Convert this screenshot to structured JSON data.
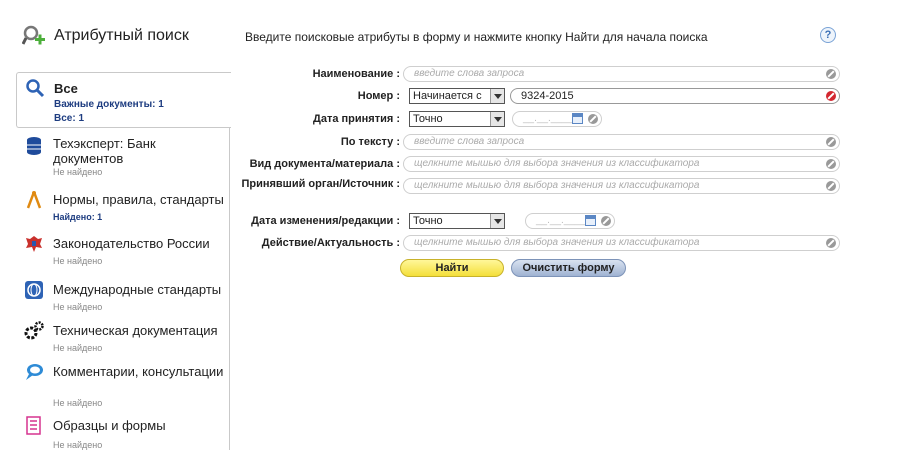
{
  "header": {
    "title": "Атрибутный поиск",
    "instruction": "Введите поисковые атрибуты в форму и нажмите кнопку Найти для начала поиска",
    "help": "?"
  },
  "sidebar": {
    "items": [
      {
        "label": "Все",
        "sub1": "Важные документы: 1",
        "sub2": "Все: 1",
        "icon": "search-icon"
      },
      {
        "label": "Техэксперт: Банк документов",
        "sub": "Не найдено",
        "icon": "database-icon"
      },
      {
        "label": "Нормы, правила, стандарты",
        "sub": "Найдено: 1",
        "icon": "compass-icon"
      },
      {
        "label": "Законодательство России",
        "sub": "Не найдено",
        "icon": "emblem-icon"
      },
      {
        "label": "Международные стандарты",
        "sub": "Не найдено",
        "icon": "globe-icon"
      },
      {
        "label": "Техническая документация",
        "sub": "Не найдено",
        "icon": "gears-icon"
      },
      {
        "label": "Комментарии, консультации",
        "sub": "Не найдено",
        "icon": "chat-icon"
      },
      {
        "label": "Образцы и формы",
        "sub": "Не найдено",
        "icon": "form-icon"
      }
    ]
  },
  "form": {
    "name_label": "Наименование :",
    "name_placeholder": "введите слова запроса",
    "number_label": "Номер :",
    "number_mode": "Начинается с",
    "number_value": "9324-2015",
    "accept_date_label": "Дата принятия :",
    "accept_date_mode": "Точно",
    "date_placeholder": "__.__.____",
    "text_label": "По тексту :",
    "text_placeholder": "введите слова запроса",
    "doctype_label": "Вид документа/материала :",
    "classifier_placeholder": "щелкните мышью для выбора значения из классификатора",
    "org_label": "Принявший орган/Источник :",
    "change_date_label": "Дата изменения/редакции :",
    "change_date_mode": "Точно",
    "status_label": "Действие/Актуальность :",
    "find_button": "Найти",
    "clear_button": "Очистить форму"
  },
  "colors": {
    "accent_blue": "#1d3c80",
    "find_yellow": "#f4df3a",
    "clear_red": "#d3272f"
  }
}
